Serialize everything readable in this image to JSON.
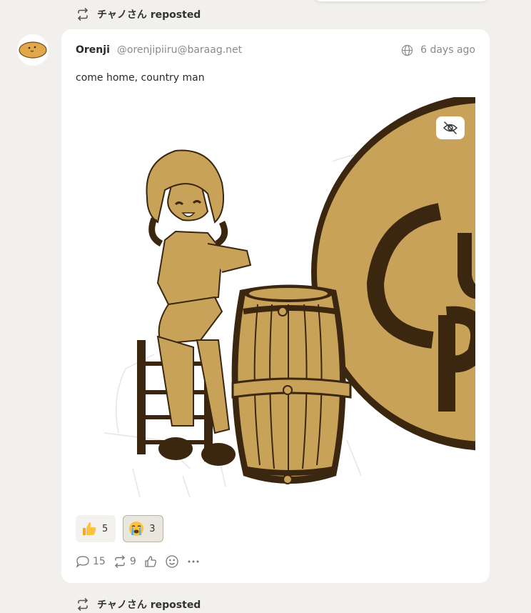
{
  "timeline": {
    "repost_top": {
      "user": "チャノさん",
      "label": "reposted"
    },
    "repost_bottom": {
      "user": "チャノさん",
      "label": "reposted"
    }
  },
  "post": {
    "author": {
      "name": "Orenji",
      "handle": "@orenjipiiru@baraag.net"
    },
    "visibility_icon": "globe-icon",
    "time": "6 days ago",
    "text": "come home, country man",
    "media": {
      "kind": "illustration",
      "hide_icon": "eye-slash-icon"
    },
    "reactions": [
      {
        "emoji_icon": "thumbs-up-emoji",
        "count": "5",
        "active": false
      },
      {
        "emoji_icon": "crying-face-emoji",
        "count": "3",
        "active": true
      }
    ],
    "actions": {
      "reply_count": "15",
      "boost_count": "9",
      "like_icon": "thumbs-up-icon",
      "react_icon": "smiley-icon",
      "more_icon": "more-icon"
    }
  },
  "colors": {
    "background": "#f1f0ec",
    "card": "#ffffff",
    "muted_text": "#8a8a8a",
    "illustration_gold": "#c8a258",
    "illustration_dark": "#3b2710"
  }
}
